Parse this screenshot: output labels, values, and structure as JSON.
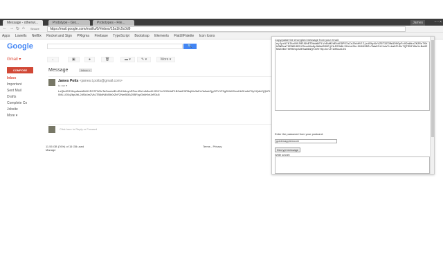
{
  "browser": {
    "tabs": [
      {
        "label": "Message - otherwi..."
      },
      {
        "label": "Prototype - Gro..."
      },
      {
        "label": "Prototypes - File..."
      }
    ],
    "user": "James",
    "window_controls": "– ▫ ×",
    "nav": {
      "back": "←",
      "forward": "→",
      "reload": "↻",
      "home": "⌂"
    },
    "secure_label": "Secure",
    "url": "https://mail.google.com/mail/u/0/#inbox/15a1fc5c0d9",
    "bookmarks": [
      "Apps",
      "Lowells",
      "Netflix",
      "Rocket and Sign",
      "PRigma",
      "Firebase",
      "TypeScript",
      "Bootstrap",
      "Elements",
      "FlatUIPalette",
      "Icon Icons"
    ]
  },
  "gmail": {
    "logo": "Google",
    "search_button": "🔍",
    "app_label": "Gmail ▾",
    "compose": "COMPOSE",
    "folders": [
      "Inbox",
      "Important",
      "Sent Mail",
      "Drafts",
      "Complete Co",
      "Jobsite",
      "More ▾"
    ],
    "toolbar": [
      "←",
      "▣",
      "●",
      "🗑",
      "▬ ▾",
      "✎ ▾",
      "More ▾"
    ],
    "subject": "Message",
    "label_badge": "Inbox ×",
    "sender": "James Potts",
    "sender_email": "<james.t.potts@gmail.com>",
    "to": "to me ▾",
    "body": "LzQkdGS3Kqo8wsMfdH1RC3TW0cTaZmnbdEmRrHh6oyhRFmnfSx1cMfvzlKJfGXYvOO3fddF1BZahE9R5ujMu3sErVbAwkCjgCRY1P2g2MkX2kmHk2KmfeF0yXQdhCjQhPt0MLLO0q2kpUbL2dSk4m2VkLTB6dN4M0b0rZbF2NmB0lAZ9BFpyGhkKfvfJzR3u5",
    "reply_placeholder": "Click here to Reply or Forward",
    "usage": "11.55 GB (76%) of 15 GB used",
    "manage": "Manage",
    "terms": "Terms - Privacy"
  },
  "extension": {
    "encrypted_label": "Copy/paste the encrypted message from your email:",
    "encrypted_value": "eyJpdiI6IkxNVUVEUGhBTDdwWVFLVzEwM2dEbkE9PSIsInZhbHVlIjoiRkpGcVZ6T3ZCNW1DOGpFcU9nWkxZK2RuTXhkRWMxaTZEN0U0MlZ3cm1HaGp3dWd3SURjZkJMYW8rS0xkd3hrOU9USDZsTWw2S1J1aVYxbm5FU0xTQTRSZlBwYzBaUEN3ZXBxTXRHUkp3ZE5wWk9QY2VhYXpJcnJTZXBiaCJ9",
    "password_label": "Enter the password from your postcard:",
    "password_value": "goldenapplemoore",
    "decrypt_button": "Decrypt message",
    "result_label": "Write secret:",
    "result_value": ""
  }
}
